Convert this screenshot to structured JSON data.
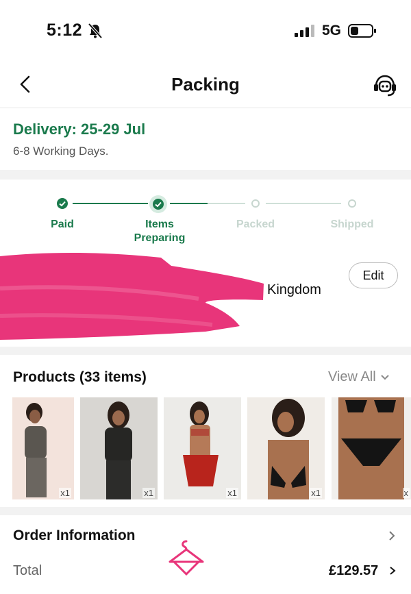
{
  "status_bar": {
    "time": "5:12",
    "network": "5G",
    "icons": [
      "bell-slash-icon",
      "signal-icon",
      "battery-icon"
    ]
  },
  "nav": {
    "title": "Packing",
    "back_icon": "chevron-left-icon",
    "support_icon": "customer-service-icon"
  },
  "delivery": {
    "title": "Delivery: 25-29 Jul",
    "subtitle": "6-8 Working Days."
  },
  "progress": {
    "steps": [
      {
        "label": "Paid",
        "state": "done"
      },
      {
        "label": "Items Preparing",
        "state": "current"
      },
      {
        "label": "Packed",
        "state": "pending"
      },
      {
        "label": "Shipped",
        "state": "pending"
      }
    ],
    "colors": {
      "active": "#1a7a4c",
      "inactive": "#cfe0d8",
      "active_text": "#1a7a4c",
      "inactive_text": "#c7d6cf"
    }
  },
  "address": {
    "visible_text": "Kingdom",
    "edit_label": "Edit"
  },
  "products": {
    "title": "Products (33 items)",
    "view_all_label": "View All",
    "items": [
      {
        "qty": "x1"
      },
      {
        "qty": "x1"
      },
      {
        "qty": "x1"
      },
      {
        "qty": "x1"
      },
      {
        "qty": "x"
      }
    ]
  },
  "order_info": {
    "title": "Order Information",
    "total_label": "Total",
    "total_value": "£129.57"
  },
  "colors": {
    "brand_green": "#1a7a4c",
    "redaction_pink": "#e8357a",
    "logo_pink": "#e8357a"
  }
}
